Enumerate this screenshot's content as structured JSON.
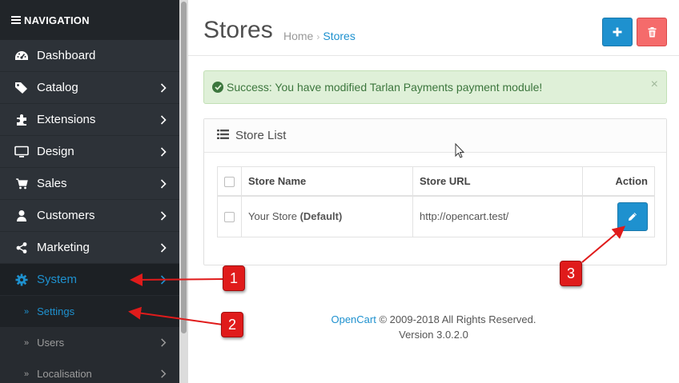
{
  "sidebar": {
    "header": "NAVIGATION",
    "items": [
      {
        "label": "Dashboard",
        "icon": "dashboard-icon"
      },
      {
        "label": "Catalog",
        "icon": "tags-icon"
      },
      {
        "label": "Extensions",
        "icon": "puzzle-icon"
      },
      {
        "label": "Design",
        "icon": "monitor-icon"
      },
      {
        "label": "Sales",
        "icon": "cart-icon"
      },
      {
        "label": "Customers",
        "icon": "user-icon"
      },
      {
        "label": "Marketing",
        "icon": "share-icon"
      },
      {
        "label": "System",
        "icon": "gear-icon"
      }
    ],
    "subitems": [
      {
        "label": "Settings"
      },
      {
        "label": "Users"
      },
      {
        "label": "Localisation"
      }
    ]
  },
  "page": {
    "title": "Stores",
    "breadcrumb": [
      "Home",
      "Stores"
    ]
  },
  "alert": {
    "message": "Success: You have modified Tarlan Payments payment module!",
    "close": "×"
  },
  "panel": {
    "title": "Store List",
    "columns": [
      "Store Name",
      "Store URL",
      "Action"
    ],
    "rows": [
      {
        "name": "Your Store",
        "tag": "(Default)",
        "url": "http://opencart.test/"
      }
    ]
  },
  "footer": {
    "link": "OpenCart",
    "copyright": "© 2009-2018 All Rights Reserved.",
    "version": "Version 3.0.2.0"
  },
  "callouts": [
    "1",
    "2",
    "3"
  ],
  "colors": {
    "sidebar_bg": "#2d3238",
    "accent": "#1e91cf",
    "danger": "#f56b6b",
    "success_bg": "#dff0d8",
    "callout": "#e01b1b"
  }
}
